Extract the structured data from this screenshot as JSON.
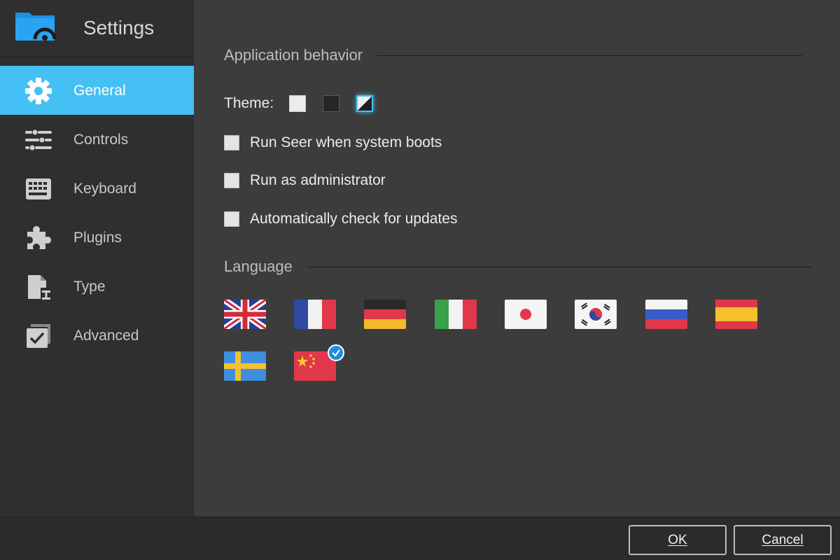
{
  "window": {
    "title": "Settings"
  },
  "sidebar": {
    "items": [
      {
        "label": "General",
        "icon": "gear-icon",
        "active": true
      },
      {
        "label": "Controls",
        "icon": "sliders-icon",
        "active": false
      },
      {
        "label": "Keyboard",
        "icon": "keyboard-icon",
        "active": false
      },
      {
        "label": "Plugins",
        "icon": "puzzle-icon",
        "active": false
      },
      {
        "label": "Type",
        "icon": "file-type-icon",
        "active": false
      },
      {
        "label": "Advanced",
        "icon": "checkbox-icon",
        "active": false
      }
    ]
  },
  "general": {
    "app_behavior_title": "Application behavior",
    "theme_label": "Theme:",
    "theme_options": [
      "light",
      "dark",
      "auto"
    ],
    "theme_selected": "auto",
    "options": [
      {
        "label": "Run Seer when system boots",
        "checked": false
      },
      {
        "label": "Run as administrator",
        "checked": false
      },
      {
        "label": "Automatically check for updates",
        "checked": false
      }
    ],
    "language_title": "Language",
    "languages": [
      "en",
      "fr",
      "de",
      "it",
      "ja",
      "ko",
      "ru",
      "es",
      "sv",
      "zh"
    ],
    "language_selected": "zh"
  },
  "footer": {
    "ok_label": "OK",
    "cancel_label": "Cancel"
  },
  "colors": {
    "accent": "#44c0f5",
    "selected_badge": "#1d8fe0"
  }
}
